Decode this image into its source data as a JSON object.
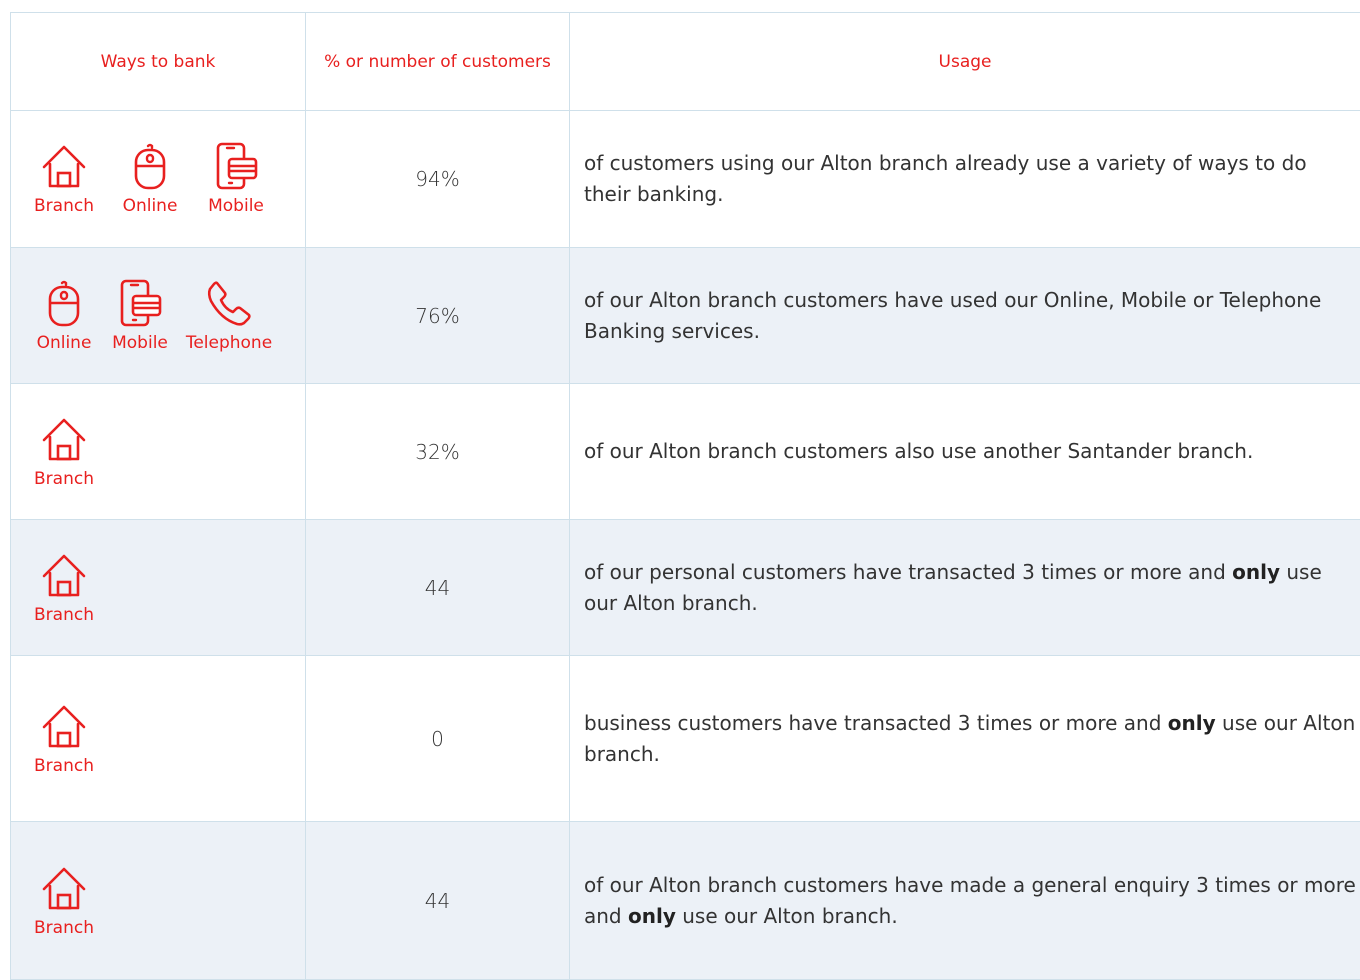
{
  "header": {
    "col1": "Ways to bank",
    "col2": "% or number of customers",
    "col3": "Usage"
  },
  "labels": {
    "branch": "Branch",
    "online": "Online",
    "mobile": "Mobile",
    "telephone": "Telephone"
  },
  "colors": {
    "accent": "#e8201f",
    "row_alt": "#ecf1f7",
    "border": "#cfe0ea"
  },
  "rows": [
    {
      "value": "94%",
      "usage": "of customers using our Alton branch already use a variety of ways to do their banking."
    },
    {
      "value": "76%",
      "usage": "of our Alton branch customers have used our Online, Mobile or Telephone Banking services."
    },
    {
      "value": "32%",
      "usage": "of our Alton branch customers also use another Santander branch."
    },
    {
      "value": "44",
      "usage_pre": "of our personal customers have transacted 3 times or more and ",
      "usage_bold": "only",
      "usage_post": " use our Alton branch."
    },
    {
      "value": "0",
      "usage_pre": "business customers have transacted 3 times or more and ",
      "usage_bold": "only",
      "usage_post": " use our Alton branch."
    },
    {
      "value": "44",
      "usage_pre": "of our Alton branch customers have made a general enquiry 3 times or more and ",
      "usage_bold": "only",
      "usage_post": " use our Alton branch."
    }
  ]
}
